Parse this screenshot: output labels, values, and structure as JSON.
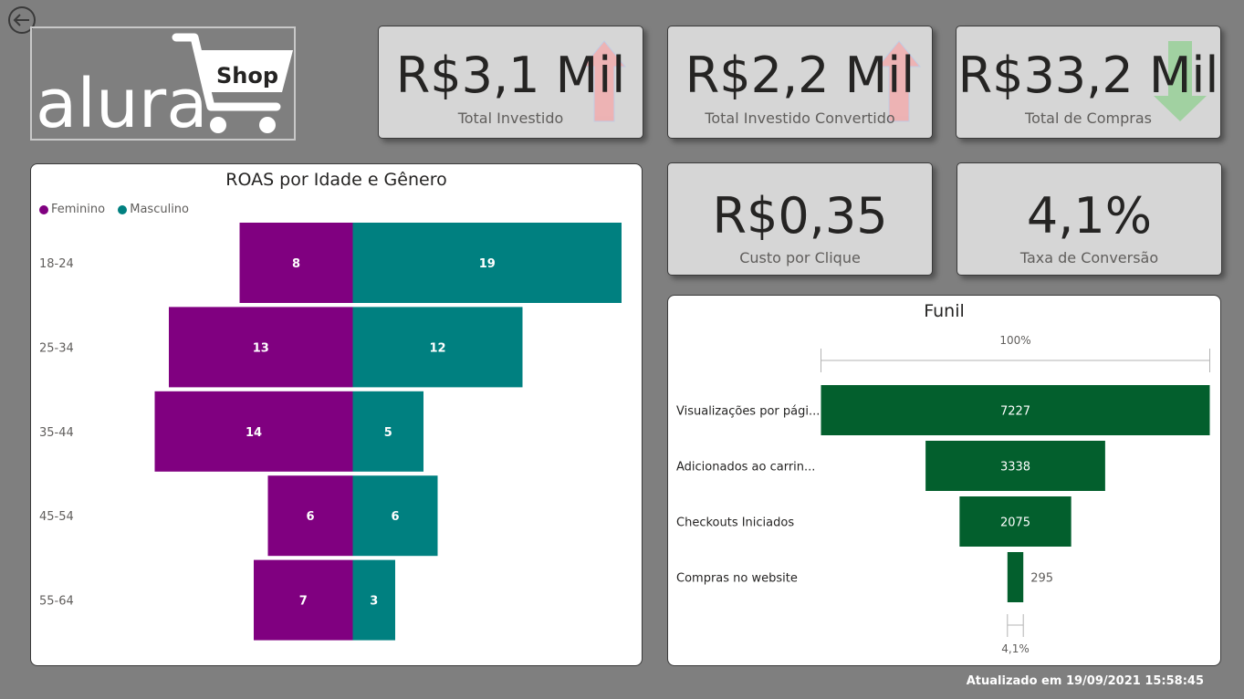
{
  "header": {
    "back_button_icon": "back-arrow-icon",
    "logo": {
      "brand": "alura",
      "badge": "Shop"
    }
  },
  "kpis": [
    {
      "value": "R$3,1 Mil",
      "label": "Total Investido",
      "trend": "up",
      "trend_color": "#f4a7a8"
    },
    {
      "value": "R$2,2 Mil",
      "label": "Total Investido Convertido",
      "trend": "up",
      "trend_color": "#f4a7a8"
    },
    {
      "value": "R$33,2 Mil",
      "label": "Total de Compras",
      "trend": "down",
      "trend_color": "#8fcf8f"
    },
    {
      "value": "R$0,35",
      "label": "Custo por Clique"
    },
    {
      "value": "4,1%",
      "label": "Taxa de Conversão"
    }
  ],
  "chart_data": [
    {
      "type": "bar",
      "orientation": "horizontal-diverging",
      "title": "ROAS por Idade e Gênero",
      "categories": [
        "18-24",
        "25-34",
        "35-44",
        "45-54",
        "55-64"
      ],
      "series": [
        {
          "name": "Feminino",
          "color": "#800080",
          "values": [
            8,
            13,
            14,
            6,
            7
          ]
        },
        {
          "name": "Masculino",
          "color": "#008080",
          "values": [
            19,
            12,
            5,
            6,
            3
          ]
        }
      ],
      "legend_position": "top-left"
    },
    {
      "type": "funnel",
      "title": "Funil",
      "categories": [
        "Visualizações por pági...",
        "Adicionados ao carrin...",
        "Checkouts Iniciados",
        "Compras no website"
      ],
      "values": [
        7227,
        3338,
        2075,
        295
      ],
      "value_labels": [
        "7227",
        "3338",
        "2075",
        "295"
      ],
      "top_percent_label": "100%",
      "bottom_percent_label": "4,1%",
      "color": "#035f2d"
    }
  ],
  "footer": {
    "updated": "Atualizado em 19/09/2021 15:58:45"
  }
}
